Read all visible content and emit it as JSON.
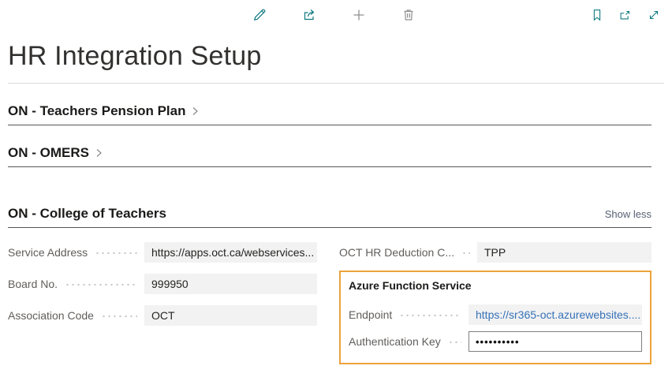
{
  "page": {
    "title": "HR Integration Setup"
  },
  "toolbar": {
    "center_icons": [
      "edit-icon",
      "share-icon",
      "add-icon",
      "delete-icon"
    ],
    "right_icons": [
      "bookmark-icon",
      "popout-icon",
      "expand-icon"
    ]
  },
  "sections": [
    {
      "label": "ON - Teachers Pension Plan",
      "collapsed": true
    },
    {
      "label": "ON - OMERS",
      "collapsed": true
    },
    {
      "label": "ON - College of Teachers",
      "collapsed": false,
      "action": "Show less"
    }
  ],
  "fields": {
    "left": [
      {
        "label": "Service Address",
        "value": "https://apps.oct.ca/webservices..."
      },
      {
        "label": "Board No.",
        "value": "999950"
      },
      {
        "label": "Association Code",
        "value": "OCT"
      }
    ],
    "right": [
      {
        "label": "OCT HR Deduction C...",
        "value": "TPP"
      }
    ]
  },
  "azure_group": {
    "title": "Azure Function Service",
    "fields": [
      {
        "label": "Endpoint",
        "value": "https://sr365-oct.azurewebsites....",
        "type": "link"
      },
      {
        "label": "Authentication Key",
        "value": "••••••••••",
        "type": "password"
      }
    ]
  },
  "colors": {
    "accent_teal": "#0e7a80",
    "highlight_border": "#eca33b",
    "link_blue": "#3571b8",
    "field_bg": "#f2f2f2"
  }
}
